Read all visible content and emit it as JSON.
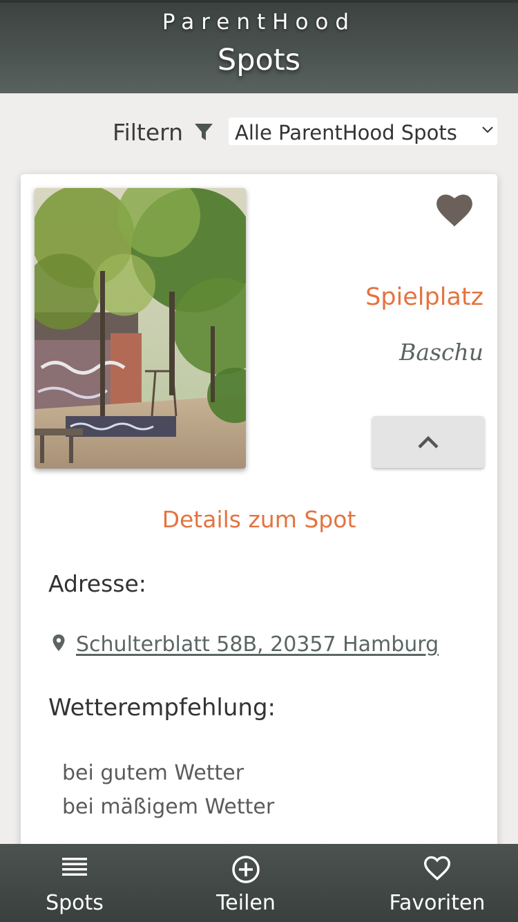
{
  "app": {
    "brand": "ParentHood",
    "title": "Spots"
  },
  "filter": {
    "label": "Filtern",
    "icon": "filter-icon",
    "selected": "Alle ParentHood Spots"
  },
  "spot": {
    "category": "Spielplatz",
    "name": "Baschu",
    "favorite_icon": "heart-icon",
    "collapse_icon": "chevron-up-icon",
    "details_title": "Details zum Spot",
    "address_label": "Adresse:",
    "address": "Schulterblatt 58B, 20357 Hamburg",
    "weather_label": "Wetterempfehlung:",
    "weather": [
      "bei gutem Wetter",
      "bei mäßigem Wetter"
    ]
  },
  "nav": [
    {
      "label": "Spots",
      "icon": "list-icon"
    },
    {
      "label": "Teilen",
      "icon": "add-circle-icon"
    },
    {
      "label": "Favoriten",
      "icon": "heart-outline-icon"
    }
  ],
  "colors": {
    "accent": "#e4733f",
    "header": "#4b5350",
    "heart": "#6b615a",
    "background": "#efeeec"
  }
}
